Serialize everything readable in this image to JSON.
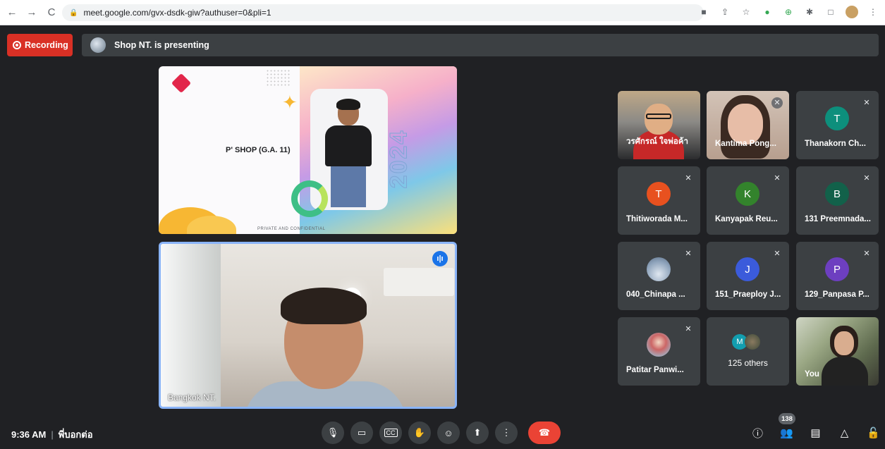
{
  "browser": {
    "url": "meet.google.com/gvx-dsdk-giw?authuser=0&pli=1",
    "nav": {
      "back": "←",
      "forward": "→",
      "reload": "C"
    }
  },
  "meet": {
    "recording_label": "Recording",
    "presenting_text": "Shop NT. is presenting"
  },
  "slide": {
    "title": "P' SHOP (G.A. 11)",
    "year": "2024",
    "footer": "PRIVATE AND CONFIDENTIAL"
  },
  "speaker": {
    "name": "Bangkok NT."
  },
  "participants": [
    {
      "name": "วรศักรณ์ ใจพ่อค้า",
      "type": "video1",
      "muted": false
    },
    {
      "name": "Kantima Pong...",
      "type": "video2",
      "muted": true
    },
    {
      "name": "Thanakorn Ch...",
      "initial": "T",
      "color": "#0d8f7c",
      "muted": true
    },
    {
      "name": "Thitiworada M...",
      "initial": "T",
      "color": "#e8511f",
      "muted": true
    },
    {
      "name": "Kanyapak Reu...",
      "initial": "K",
      "color": "#33832c",
      "muted": true
    },
    {
      "name": "131 Preemnada...",
      "initial": "B",
      "color": "#12614a",
      "muted": true
    },
    {
      "name": "040_Chinapa ...",
      "type": "sky",
      "muted": true
    },
    {
      "name": "151_Praeploy J...",
      "initial": "J",
      "color": "#3b5bdb",
      "muted": true
    },
    {
      "name": "129_Panpasa P...",
      "initial": "P",
      "color": "#6d3fc0",
      "muted": true
    },
    {
      "name": "Patitar Panwi...",
      "type": "photo",
      "muted": true
    }
  ],
  "others": {
    "label": "125 others",
    "initial": "M",
    "color": "#129eaf"
  },
  "self": {
    "name": "You"
  },
  "footer": {
    "time": "9:36 AM",
    "meeting_code": "พี่บอกต่อ",
    "participant_count": "138"
  },
  "colors": {
    "background": "#202124",
    "recording": "#d93025",
    "end_call": "#ea4335",
    "speaker_border": "#8ab4f8"
  },
  "icons": {
    "mic": "microphone-icon",
    "camera": "camera-icon",
    "captions": "captions-icon",
    "hand": "raise-hand-icon",
    "emoji": "emoji-icon",
    "present": "present-screen-icon",
    "more": "more-options-icon",
    "end": "end-call-icon",
    "info": "info-icon",
    "people": "people-icon",
    "chat": "chat-icon",
    "activities": "activities-icon",
    "host": "host-controls-icon"
  }
}
